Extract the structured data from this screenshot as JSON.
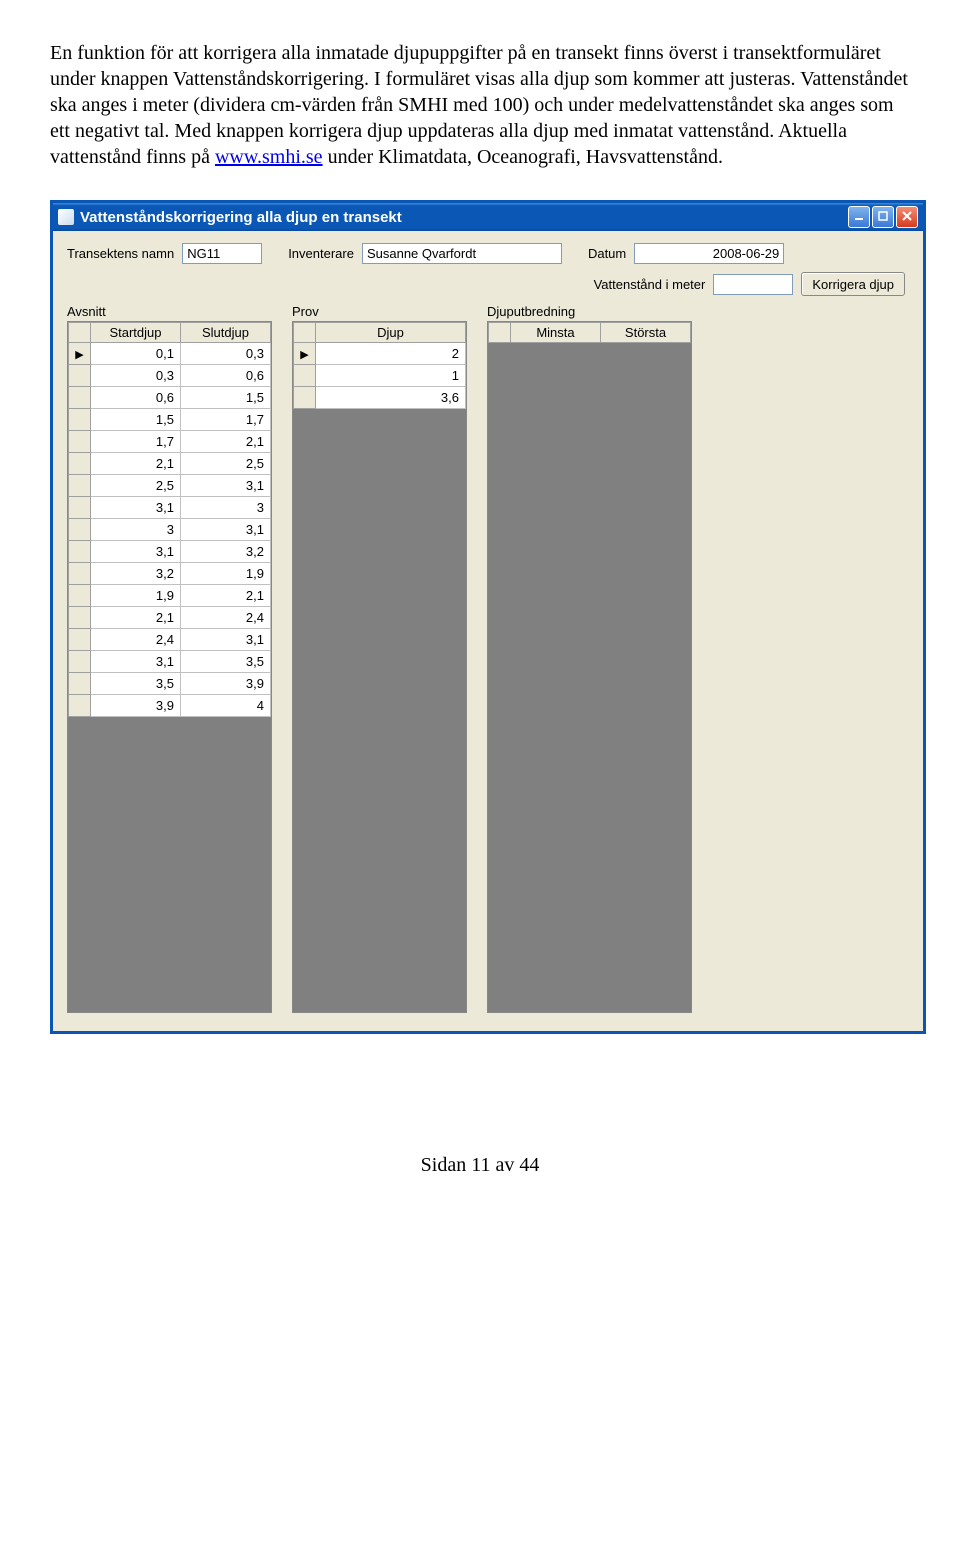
{
  "doc": {
    "p1a": "En funktion för att korrigera alla inmatade djupuppgifter på en transekt finns överst i transektformuläret under knappen Vattenståndskorrigering. I formuläret visas alla djup som kommer att justeras. Vattenståndet ska anges i meter (dividera cm-värden från SMHI med 100) och under medelvattenståndet ska anges som ett negativt tal. Med knappen korrigera djup uppdateras alla djup med inmatat vattenstånd. Aktuella vattenstånd finns på ",
    "link_text": "www.smhi.se",
    "p1b": " under Klimatdata, Oceanografi, Havsvattenstånd."
  },
  "window": {
    "title": "Vattenståndskorrigering alla djup en transekt",
    "labels": {
      "transekt": "Transektens namn",
      "inventerare": "Inventerare",
      "datum": "Datum",
      "vattenstand": "Vattenstånd i meter"
    },
    "values": {
      "transekt": "NG11",
      "inventerare": "Susanne Qvarfordt",
      "datum": "2008-06-29",
      "vattenstand": ""
    },
    "buttons": {
      "korrigera": "Korrigera djup"
    },
    "grids": {
      "avsnitt": {
        "title": "Avsnitt",
        "headers": [
          "Startdjup",
          "Slutdjup"
        ],
        "rows": [
          [
            "0,1",
            "0,3"
          ],
          [
            "0,3",
            "0,6"
          ],
          [
            "0,6",
            "1,5"
          ],
          [
            "1,5",
            "1,7"
          ],
          [
            "1,7",
            "2,1"
          ],
          [
            "2,1",
            "2,5"
          ],
          [
            "2,5",
            "3,1"
          ],
          [
            "3,1",
            "3"
          ],
          [
            "3",
            "3,1"
          ],
          [
            "3,1",
            "3,2"
          ],
          [
            "3,2",
            "1,9"
          ],
          [
            "1,9",
            "2,1"
          ],
          [
            "2,1",
            "2,4"
          ],
          [
            "2,4",
            "3,1"
          ],
          [
            "3,1",
            "3,5"
          ],
          [
            "3,5",
            "3,9"
          ],
          [
            "3,9",
            "4"
          ]
        ]
      },
      "prov": {
        "title": "Prov",
        "headers": [
          "Djup"
        ],
        "rows": [
          [
            "2"
          ],
          [
            "1"
          ],
          [
            "3,6"
          ]
        ]
      },
      "djuputbredning": {
        "title": "Djuputbredning",
        "headers": [
          "Minsta",
          "Största"
        ],
        "rows": []
      }
    }
  },
  "footer": "Sidan 11 av 44"
}
